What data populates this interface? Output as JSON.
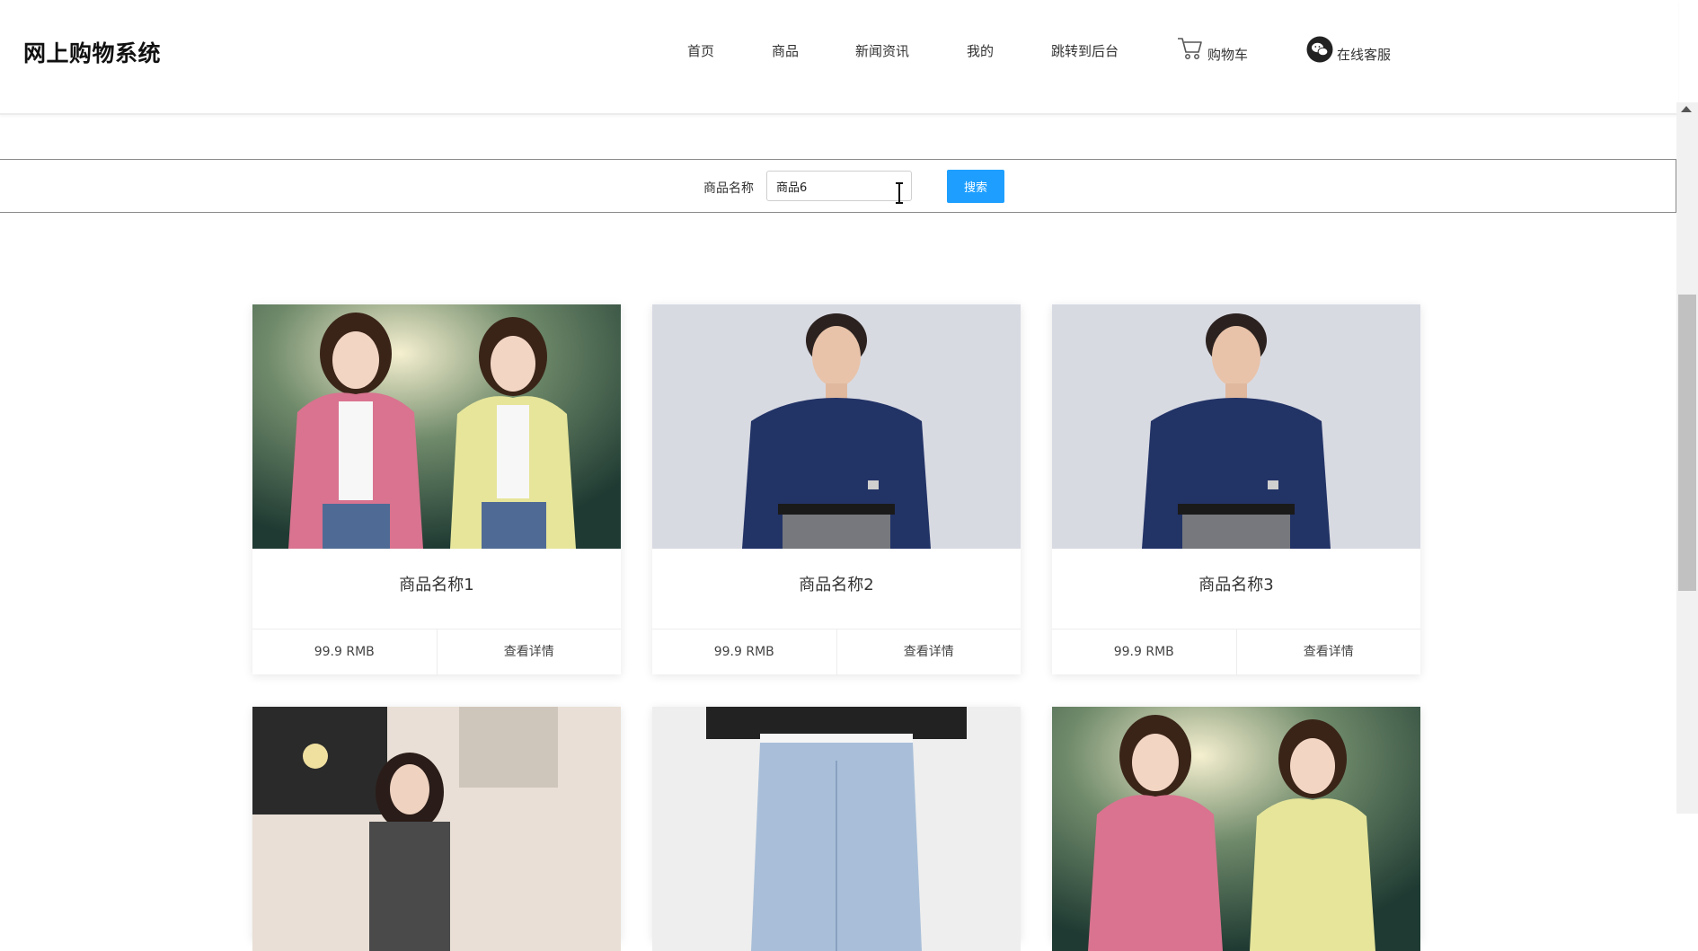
{
  "app": {
    "title": "网上购物系统"
  },
  "nav": {
    "items": [
      {
        "label": "首页"
      },
      {
        "label": "商品"
      },
      {
        "label": "新闻资讯"
      },
      {
        "label": "我的"
      },
      {
        "label": "跳转到后台"
      },
      {
        "label": "购物车",
        "icon": "cart-icon"
      },
      {
        "label": "在线客服",
        "icon": "wechat-icon"
      }
    ]
  },
  "search": {
    "label": "商品名称",
    "value": "商品6",
    "button_label": "搜索"
  },
  "products": [
    {
      "name": "商品名称1",
      "price": "99.9 RMB",
      "detail_label": "查看详情",
      "image": "women-cardigans"
    },
    {
      "name": "商品名称2",
      "price": "99.9 RMB",
      "detail_label": "查看详情",
      "image": "man-navy-shirt"
    },
    {
      "name": "商品名称3",
      "price": "99.9 RMB",
      "detail_label": "查看详情",
      "image": "man-navy-shirt"
    }
  ],
  "products_partial": [
    {
      "image": "woman-interior"
    },
    {
      "image": "jeans"
    },
    {
      "image": "women-cardigans"
    }
  ],
  "colors": {
    "accent": "#1e9fff",
    "logo": "#111111"
  }
}
